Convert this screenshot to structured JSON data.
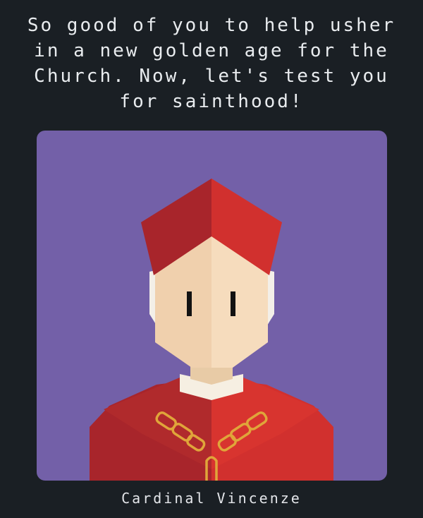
{
  "dialogue": {
    "text": "So good of you to help usher\nin a new golden age for the\nChurch. Now, let's test you\nfor sainthood!"
  },
  "character": {
    "name": "Cardinal Vincenze"
  },
  "icons": {
    "portrait": "cardinal-portrait"
  },
  "colors": {
    "background": "#1a1f24",
    "portrait_bg": "#7360a8",
    "robe_red": "#d1302e",
    "robe_dark": "#a8252b",
    "skin": "#f5d9b8",
    "gold": "#e0a53a"
  }
}
